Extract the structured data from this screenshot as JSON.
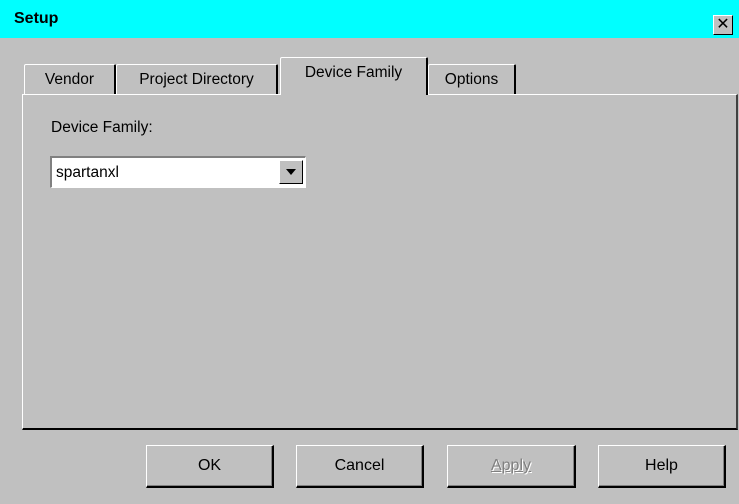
{
  "window": {
    "title": "Setup",
    "close_glyph": "✕"
  },
  "tabs": [
    {
      "label": "Vendor",
      "active": false
    },
    {
      "label": "Project Directory",
      "active": false
    },
    {
      "label": "Device Family",
      "active": true
    },
    {
      "label": "Options",
      "active": false
    }
  ],
  "device_family_page": {
    "label": "Device Family:",
    "combo": {
      "selected_value": "spartanxl",
      "arrow_icon": "chevron-down-icon"
    }
  },
  "buttons": {
    "ok": "OK",
    "cancel": "Cancel",
    "apply": "Apply",
    "help": "Help"
  },
  "colors": {
    "titlebar": "#00ffff",
    "face": "#c0c0c0",
    "disabled_text": "#808080"
  }
}
